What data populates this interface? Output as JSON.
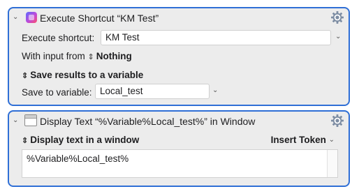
{
  "action1": {
    "title": "Execute Shortcut “KM Test”",
    "execute_label": "Execute shortcut:",
    "execute_value": "KM Test",
    "input_label": "With input from",
    "input_value": "Nothing",
    "save_results_label": "Save results to a variable",
    "save_to_label": "Save to variable:",
    "save_to_value": "Local_test"
  },
  "action2": {
    "title": "Display Text “%Variable%Local_test%” in Window",
    "display_mode": "Display text in a window",
    "insert_token_label": "Insert Token",
    "text_value": "%Variable%Local_test%"
  },
  "icons": {
    "collapse": "chevron-down-icon",
    "gear": "gear-icon",
    "shortcuts_app": "shortcuts-app-icon",
    "window": "window-icon"
  },
  "colors": {
    "selection_border": "#2f6fd6",
    "panel_background": "#ececec"
  }
}
